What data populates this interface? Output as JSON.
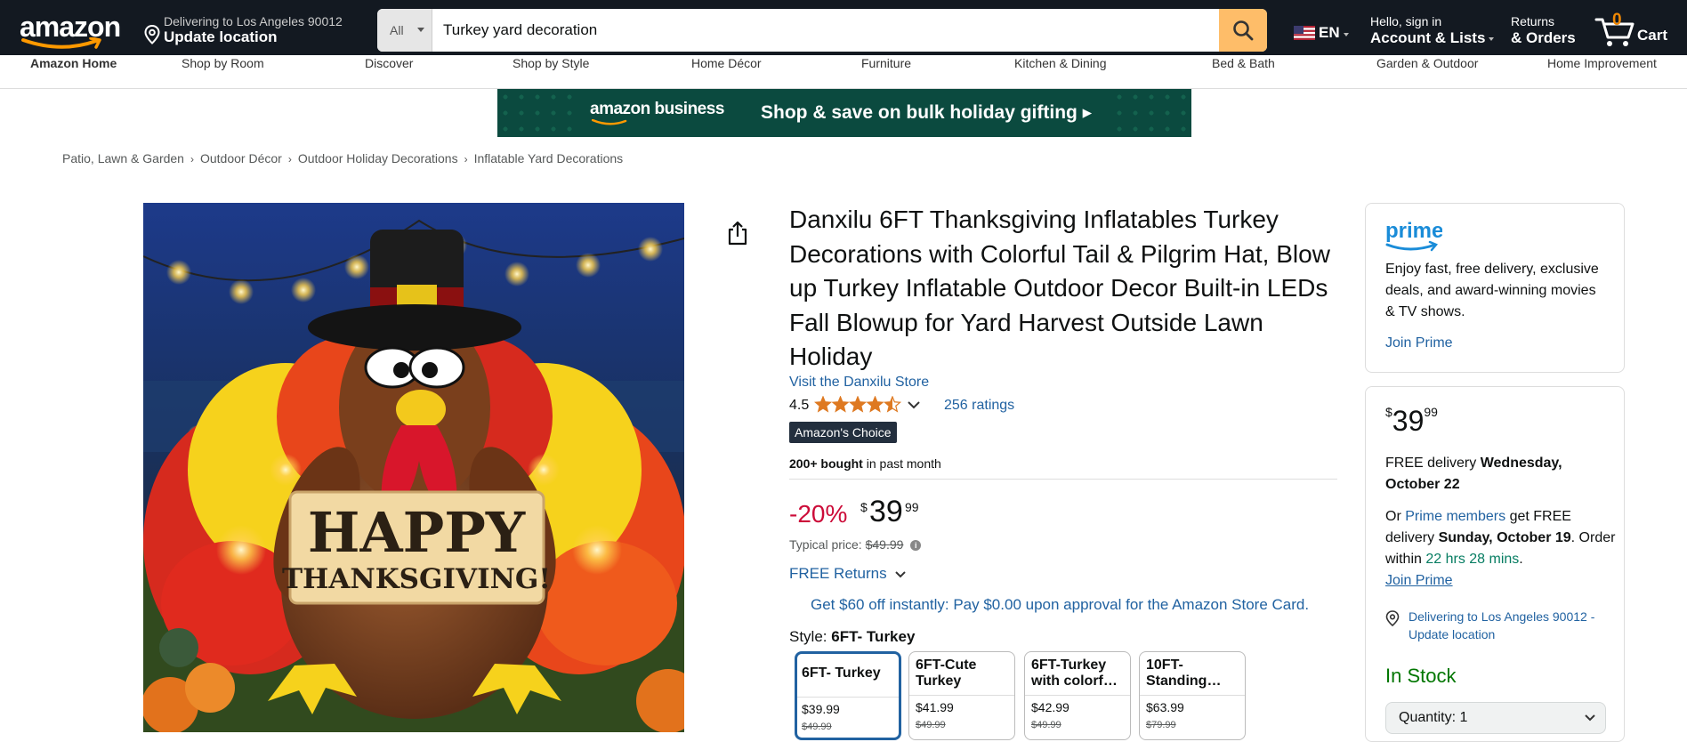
{
  "nav": {
    "logo": "amazon",
    "deliver_line1": "Delivering to Los Angeles 90012",
    "deliver_line2": "Update location",
    "search_category": "All",
    "search_value": "Turkey yard decoration",
    "lang": "EN",
    "account_line1": "Hello, sign in",
    "account_line2": "Account & Lists",
    "orders_line1": "Returns",
    "orders_line2": "& Orders",
    "cart_count": "0",
    "cart_label": "Cart"
  },
  "subnav": [
    "Amazon Home",
    "Shop by Room",
    "Discover",
    "Shop by Style",
    "Home Décor",
    "Furniture",
    "Kitchen & Dining",
    "Bed & Bath",
    "Garden & Outdoor",
    "Home Improvement"
  ],
  "banner": {
    "brand": "amazon business",
    "message": "Shop & save on bulk holiday gifting ▸"
  },
  "breadcrumb": [
    "Patio, Lawn & Garden",
    "Outdoor Décor",
    "Outdoor Holiday Decorations",
    "Inflatable Yard Decorations"
  ],
  "product": {
    "image_sign_line1": "HAPPY",
    "image_sign_line2": "THANKSGIVING!",
    "title": "Danxilu 6FT Thanksgiving Inflatables Turkey Decorations with Colorful Tail & Pilgrim Hat, Blow up Turkey Inflatable Outdoor Decor Built-in LEDs Fall Blowup for Yard Harvest Outside Lawn Holiday",
    "store": "Visit the Danxilu Store",
    "rating": "4.5",
    "rating_value": 4.5,
    "ratings_count": "256 ratings",
    "badge": "Amazon's Choice",
    "bought_bold": "200+ bought",
    "bought_rest": " in past month",
    "discount": "-20%",
    "price_symbol": "$",
    "price_whole": "39",
    "price_fraction": "99",
    "typical_label": "Typical price:",
    "typical_price": "$49.99",
    "returns": "FREE Returns",
    "card_offer": "Get $60 off instantly: Pay $0.00 upon approval for the Amazon Store Card.",
    "style_label": "Style:",
    "style_value": "6FT- Turkey",
    "styles": [
      {
        "name": "6FT- Turkey",
        "price": "$39.99",
        "was": "$49.99"
      },
      {
        "name": "6FT-Cute Turkey",
        "price": "$41.99",
        "was": "$49.99"
      },
      {
        "name": "6FT-Turkey with colorf…",
        "price": "$42.99",
        "was": "$49.99"
      },
      {
        "name": "10FT-Standing…",
        "price": "$63.99",
        "was": "$79.99"
      }
    ]
  },
  "prime": {
    "logo": "prime",
    "text": "Enjoy fast, free delivery, exclusive deals, and award-winning movies & TV shows.",
    "join": "Join Prime"
  },
  "buybox": {
    "price_symbol": "$",
    "price_whole": "39",
    "price_fraction": "99",
    "delivery_pre": "FREE delivery ",
    "delivery_date": "Wednesday, October 22",
    "alt_1": "Or ",
    "alt_prime": "Prime members",
    "alt_2": " get FREE delivery ",
    "alt_date": "Sunday, October 19",
    "alt_3": ". Order within ",
    "alt_time": "22 hrs 28 mins",
    "alt_4": ".",
    "join": "Join Prime",
    "location": "Delivering to Los Angeles 90012 - Update location",
    "stock": "In Stock",
    "quantity": "Quantity:  1"
  },
  "colors": {
    "nav_bg": "#131921",
    "search_btn": "#febd69",
    "link": "#2162a1",
    "discount": "#cc0c39",
    "stock": "#007600"
  }
}
